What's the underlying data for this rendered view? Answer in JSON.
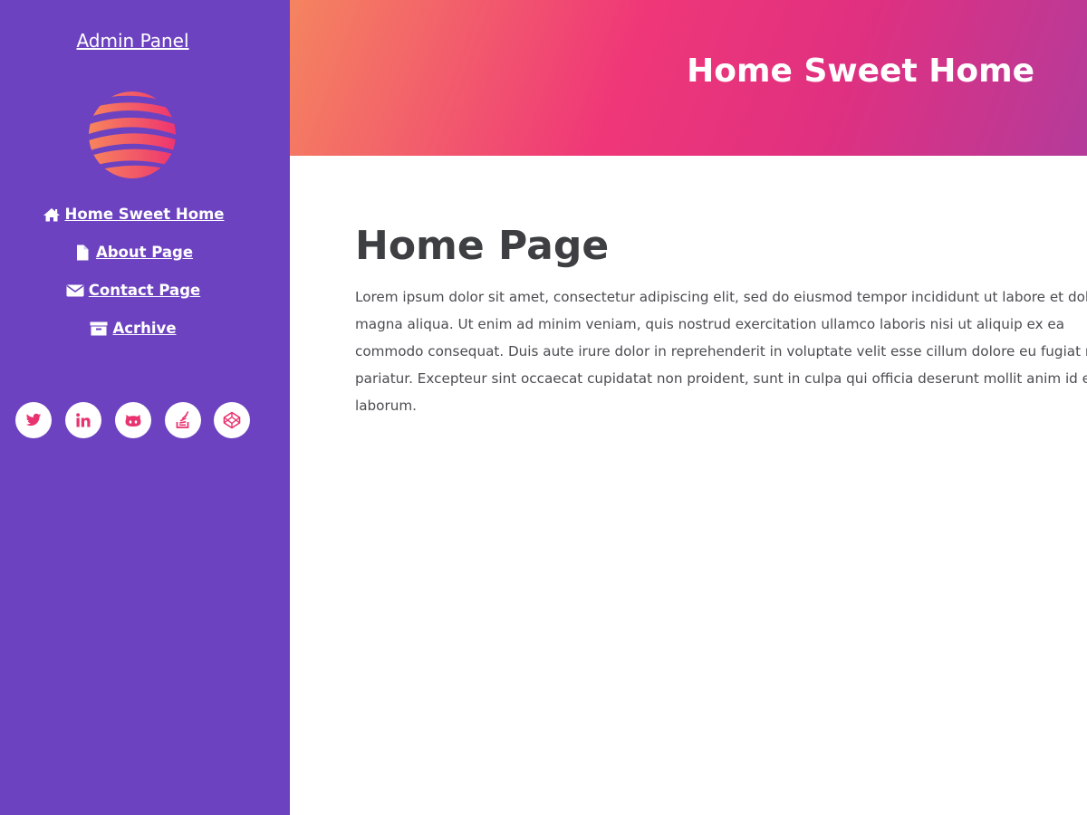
{
  "sidebar": {
    "brand": "Admin Panel",
    "logo_icon": "striped-globe-logo",
    "nav": [
      {
        "label": "Home Sweet Home",
        "icon": "home-icon"
      },
      {
        "label": "About Page",
        "icon": "file-icon"
      },
      {
        "label": "Contact Page",
        "icon": "envelope-icon"
      },
      {
        "label": "Acrhive",
        "icon": "archive-icon"
      }
    ],
    "socials": [
      {
        "name": "twitter",
        "icon": "twitter-icon"
      },
      {
        "name": "linkedin",
        "icon": "linkedin-icon"
      },
      {
        "name": "github",
        "icon": "github-icon"
      },
      {
        "name": "stackoverflow",
        "icon": "stackoverflow-icon"
      },
      {
        "name": "codepen",
        "icon": "codepen-icon"
      }
    ]
  },
  "header": {
    "title": "Home Sweet Home"
  },
  "main": {
    "title": "Home Page",
    "body": "Lorem ipsum dolor sit amet, consectetur adipiscing elit, sed do eiusmod tempor incididunt ut labore et dolore magna aliqua. Ut enim ad minim veniam, quis nostrud exercitation ullamco laboris nisi ut aliquip ex ea commodo consequat. Duis aute irure dolor in reprehenderit in voluptate velit esse cillum dolore eu fugiat nulla pariatur. Excepteur sint occaecat cupidatat non proident, sunt in culpa qui officia deserunt mollit anim id est laborum."
  },
  "colors": {
    "sidebar_bg": "#6c42c0",
    "header_gradient_start": "#f5845f",
    "header_gradient_mid": "#ef3778",
    "header_gradient_end": "#b43b9a",
    "social_icon": "#e8336e",
    "text_dark": "#3d3f42"
  }
}
